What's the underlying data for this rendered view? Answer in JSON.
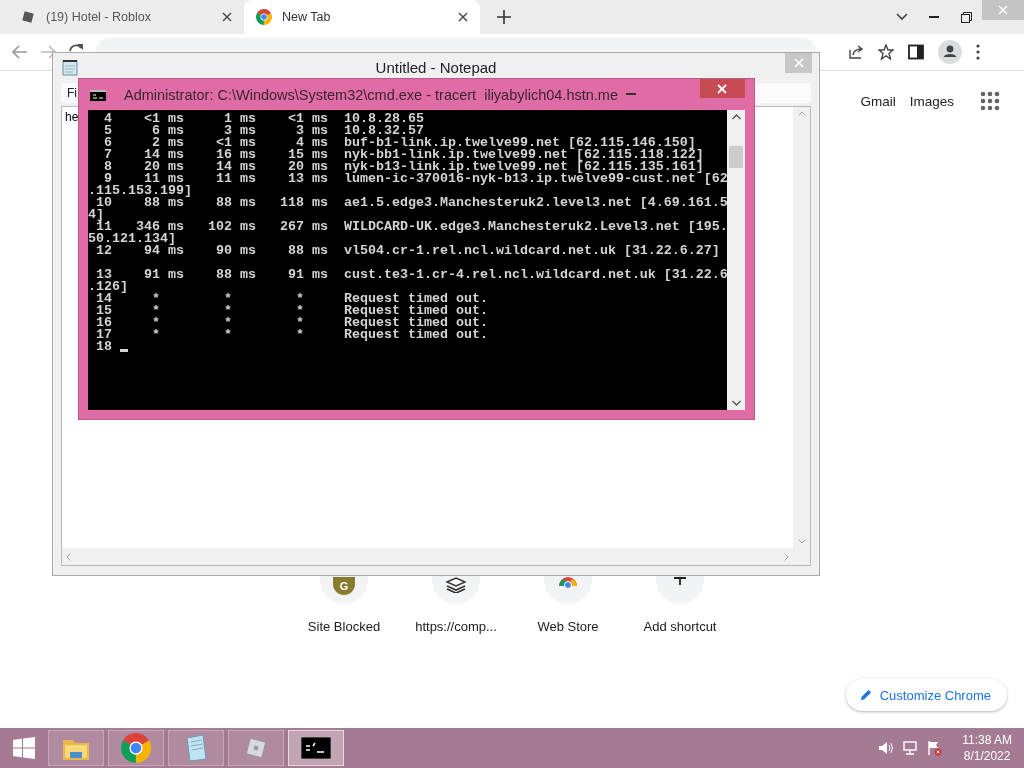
{
  "browser": {
    "tabs": [
      {
        "title": "(19) Hotel - Roblox",
        "kind": "square",
        "selected": false
      },
      {
        "title": "New Tab",
        "kind": "ring",
        "selected": true
      }
    ],
    "top_links": [
      "Gmail",
      "Images"
    ],
    "shortcuts": [
      {
        "label": "Site Blocked",
        "kind": "letter",
        "letter": "G"
      },
      {
        "label": "https://comp...",
        "kind": "stack"
      },
      {
        "label": "Web Store",
        "kind": "store"
      },
      {
        "label": "Add shortcut",
        "kind": "add"
      }
    ],
    "customize_button": "Customize Chrome"
  },
  "notepad": {
    "title": "Untitled - Notepad",
    "menu": [
      "Fi"
    ],
    "text": "he"
  },
  "cmd": {
    "title": "Administrator: C:\\Windows\\System32\\cmd.exe - tracert  iliyabylich04.hstn.me",
    "lines": [
      {
        "kind": "text",
        "text": "  4    <1 ms     1 ms    <1 ms  10.8.28.65"
      },
      {
        "kind": "text",
        "text": "  5     6 ms     3 ms     3 ms  10.8.32.57"
      },
      {
        "kind": "text",
        "text": "  6     2 ms    <1 ms     4 ms  buf-b1-link.ip.twelve99.net [62.115.146.150]"
      },
      {
        "kind": "text",
        "text": "  7    14 ms    16 ms    15 ms  nyk-bb1-link.ip.twelve99.net [62.115.118.122]"
      },
      {
        "kind": "text",
        "text": "  8    20 ms    14 ms    20 ms  nyk-b13-link.ip.twelve99.net [62.115.135.161]"
      },
      {
        "kind": "text",
        "text": "  9    11 ms    11 ms    13 ms  lumen-ic-370016-nyk-b13.ip.twelve99-cust.net [62"
      },
      {
        "kind": "text",
        "text": ".115.153.199]"
      },
      {
        "kind": "text",
        "text": " 10    88 ms    88 ms   118 ms  ae1.5.edge3.Manchesteruk2.level3.net [4.69.161.5"
      },
      {
        "kind": "text",
        "text": "4]"
      },
      {
        "kind": "text",
        "text": " 11   346 ms   102 ms   267 ms  WILDCARD-UK.edge3.Manchesteruk2.Level3.net [195."
      },
      {
        "kind": "text",
        "text": "50.121.134]"
      },
      {
        "kind": "text",
        "text": " 12    94 ms    90 ms    88 ms  vl504.cr-1.rel.ncl.wildcard.net.uk [31.22.6.27]"
      },
      {
        "kind": "blank"
      },
      {
        "kind": "text",
        "text": " 13    91 ms    88 ms    91 ms  cust.te3-1.cr-4.rel.ncl.wildcard.net.uk [31.22.6"
      },
      {
        "kind": "text",
        "text": ".126]"
      },
      {
        "kind": "text",
        "text": " 14     *        *        *     Request timed out."
      },
      {
        "kind": "text",
        "text": " 15     *        *        *     Request timed out."
      },
      {
        "kind": "text",
        "text": " 16     *        *        *     Request timed out."
      },
      {
        "kind": "text",
        "text": " 17     *        *        *     Request timed out."
      },
      {
        "kind": "text",
        "text": " 18"
      }
    ],
    "cursor": true
  },
  "taskbar": {
    "items": [
      {
        "kind": "folder",
        "selected": false
      },
      {
        "kind": "ring",
        "selected": false
      },
      {
        "kind": "notepad",
        "selected": false
      },
      {
        "kind": "square",
        "selected": false
      },
      {
        "kind": "terminal",
        "selected": true
      }
    ],
    "clock": {
      "time": "11:38 AM",
      "date": "8/1/2022"
    }
  }
}
